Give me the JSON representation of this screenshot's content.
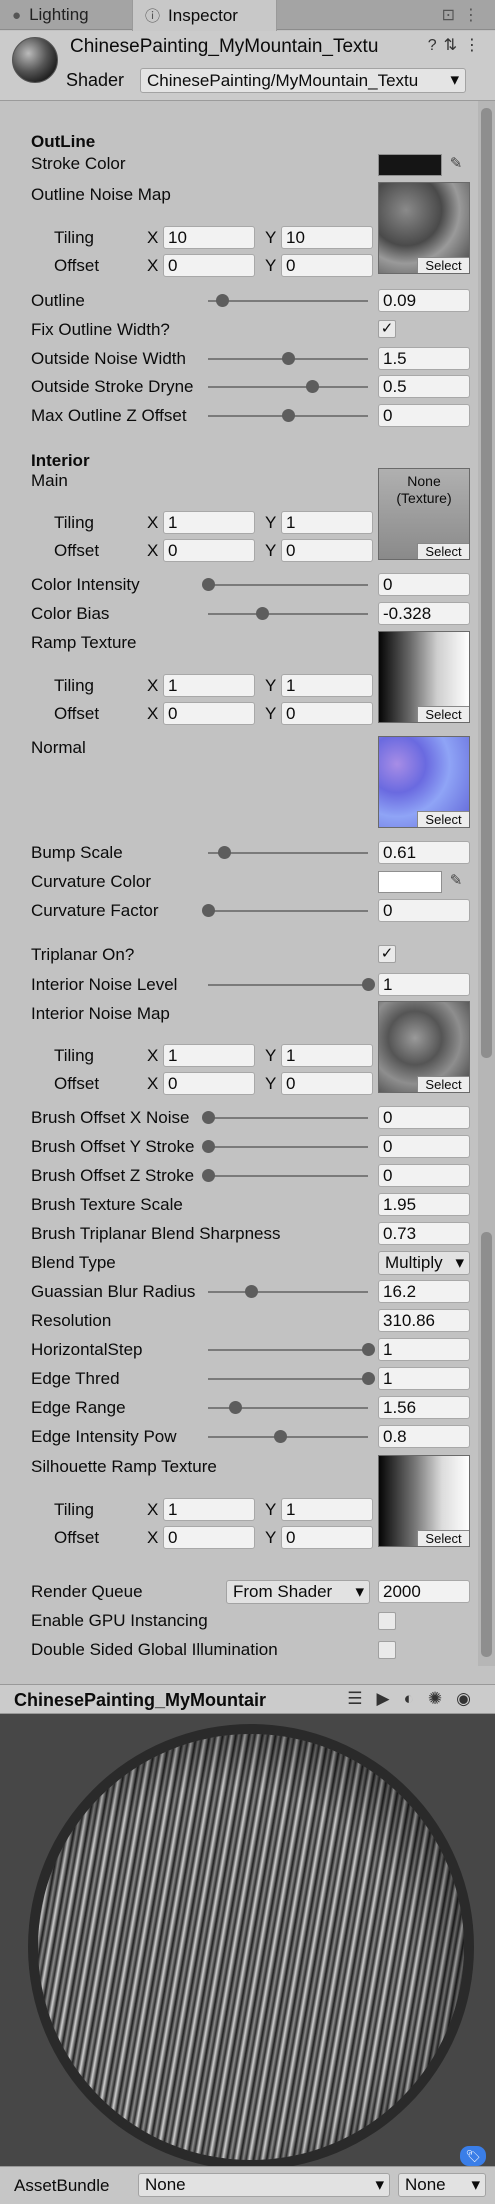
{
  "tabs": {
    "lighting": "Lighting",
    "inspector": "Inspector"
  },
  "header": {
    "material_name": "ChinesePainting_MyMountain_Textu",
    "shader_label": "Shader",
    "shader_value": "ChinesePainting/MyMountain_Textu"
  },
  "outline": {
    "heading": "OutLine",
    "stroke_color_label": "Stroke Color",
    "stroke_color": "#151515",
    "noise_map_label": "Outline Noise Map",
    "tiling_label": "Tiling",
    "offset_label": "Offset",
    "x": "X",
    "y": "Y",
    "tiling_x": "10",
    "tiling_y": "10",
    "offset_x": "0",
    "offset_y": "0",
    "select": "Select",
    "outline_label": "Outline",
    "outline_value": "0.09",
    "fix_width_label": "Fix Outline Width?",
    "outside_noise_label": "Outside Noise Width",
    "outside_noise_value": "1.5",
    "outside_dryness_label": "Outside Stroke Dryne",
    "outside_dryness_value": "0.5",
    "max_z_label": "Max Outline Z Offset",
    "max_z_value": "0"
  },
  "interior": {
    "heading": "Interior",
    "main_label": "Main",
    "none_texture": "None\n(Texture)",
    "main_tiling_x": "1",
    "main_tiling_y": "1",
    "main_offset_x": "0",
    "main_offset_y": "0",
    "color_intensity_label": "Color Intensity",
    "color_intensity_value": "0",
    "color_bias_label": "Color Bias",
    "color_bias_value": "-0.328",
    "ramp_label": "Ramp Texture",
    "ramp_tiling_x": "1",
    "ramp_tiling_y": "1",
    "ramp_offset_x": "0",
    "ramp_offset_y": "0",
    "normal_label": "Normal",
    "bump_label": "Bump Scale",
    "bump_value": "0.61",
    "curv_color_label": "Curvature Color",
    "curv_color": "#ffffff",
    "curv_factor_label": "Curvature Factor",
    "curv_factor_value": "0",
    "triplanar_label": "Triplanar On?",
    "noise_level_label": "Interior Noise Level",
    "noise_level_value": "1",
    "noise_map_label": "Interior Noise Map",
    "noise_tiling_x": "1",
    "noise_tiling_y": "1",
    "noise_offset_x": "0",
    "noise_offset_y": "0",
    "brush_x_label": "Brush Offset X Noise",
    "brush_x_value": "0",
    "brush_y_label": "Brush Offset Y Stroke",
    "brush_y_value": "0",
    "brush_z_label": "Brush Offset Z Stroke",
    "brush_z_value": "0",
    "brush_scale_label": "Brush Texture Scale",
    "brush_scale_value": "1.95",
    "brush_blend_label": "Brush Triplanar Blend Sharpness",
    "brush_blend_value": "0.73",
    "blend_type_label": "Blend Type",
    "blend_type_value": "Multiply",
    "blur_label": "Guassian Blur Radius",
    "blur_value": "16.2",
    "resolution_label": "Resolution",
    "resolution_value": "310.86",
    "hstep_label": "HorizontalStep",
    "hstep_value": "1",
    "edge_thred_label": "Edge Thred",
    "edge_thred_value": "1",
    "edge_range_label": "Edge Range",
    "edge_range_value": "1.56",
    "edge_pow_label": "Edge Intensity Pow",
    "edge_pow_value": "0.8",
    "sil_label": "Silhouette Ramp Texture",
    "sil_tiling_x": "1",
    "sil_tiling_y": "1",
    "sil_offset_x": "0",
    "sil_offset_y": "0"
  },
  "footer": {
    "render_queue_label": "Render Queue",
    "render_queue_source": "From Shader",
    "render_queue_value": "2000",
    "gpu_label": "Enable GPU Instancing",
    "double_sided_label": "Double Sided Global Illumination"
  },
  "preview": {
    "title": "ChinesePainting_MyMountair",
    "asset_bundle_label": "AssetBundle",
    "asset_bundle_value": "None",
    "asset_variant_value": "None"
  },
  "sliders": {
    "outline": 0.09,
    "outside_noise": 0.5,
    "outside_dryness": 0.65,
    "max_z": 0.5,
    "color_intensity": 0.0,
    "color_bias": 0.34,
    "bump": 0.1,
    "curv_factor": 0.0,
    "noise_level": 1.0,
    "brush_x": 0.0,
    "brush_y": 0.0,
    "brush_z": 0.0,
    "blur": 0.27,
    "hstep": 1.0,
    "edge_thred": 1.0,
    "edge_range": 0.17,
    "edge_pow": 0.45
  }
}
